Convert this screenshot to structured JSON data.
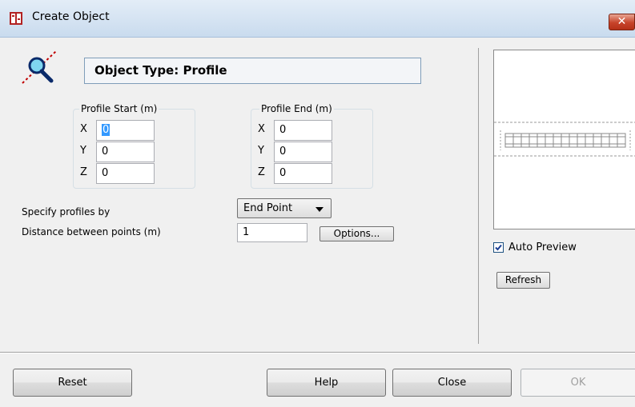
{
  "window": {
    "title": "Create Object",
    "close_symbol": "✕"
  },
  "object_type": "Object Type: Profile",
  "profile_start": {
    "label": "Profile Start (m)",
    "x_label": "X",
    "y_label": "Y",
    "z_label": "Z",
    "x": "0",
    "y": "0",
    "z": "0"
  },
  "profile_end": {
    "label": "Profile End (m)",
    "x_label": "X",
    "y_label": "Y",
    "z_label": "Z",
    "x": "0",
    "y": "0",
    "z": "0"
  },
  "specify_label": "Specify profiles by",
  "specify_value": "End Point",
  "distance_label": "Distance between points (m)",
  "distance_value": "1",
  "options_label": "Options...",
  "auto_preview": {
    "label": "Auto Preview",
    "checked": true
  },
  "refresh_label": "Refresh",
  "buttons": {
    "reset": "Reset",
    "help": "Help",
    "close": "Close",
    "ok": "OK"
  },
  "icons": {
    "title": "app-icon",
    "type": "magnifier-search-icon"
  },
  "colors": {
    "titlebar": "#c9dbee",
    "close": "#c7432a",
    "selection": "#3399ff"
  }
}
